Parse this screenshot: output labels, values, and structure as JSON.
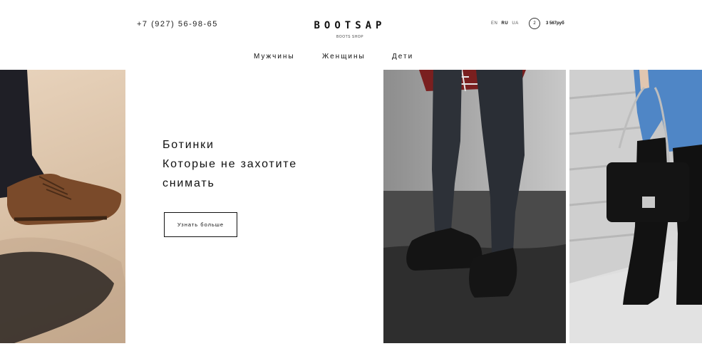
{
  "header": {
    "phone": "+7 (927) 56-98-65",
    "logo": "BOOTSAP",
    "logo_sub": "BOOTS SHOP",
    "languages": [
      "EN",
      "RU",
      "UA"
    ],
    "active_language": "RU",
    "cart_count": "2",
    "cart_total": "3 567руб"
  },
  "nav": {
    "items": [
      "Мужчины",
      "Женщины",
      "Дети"
    ]
  },
  "hero": {
    "lines": [
      "Ботинки",
      "Которые не захотите",
      "снимать"
    ],
    "button_label": "Узнать больше"
  },
  "colors": {
    "text": "#111111",
    "background": "#ffffff",
    "sand": "#d7bea3",
    "brown_boot": "#7a4a2a",
    "wet_asphalt": "#3a3a3a"
  }
}
